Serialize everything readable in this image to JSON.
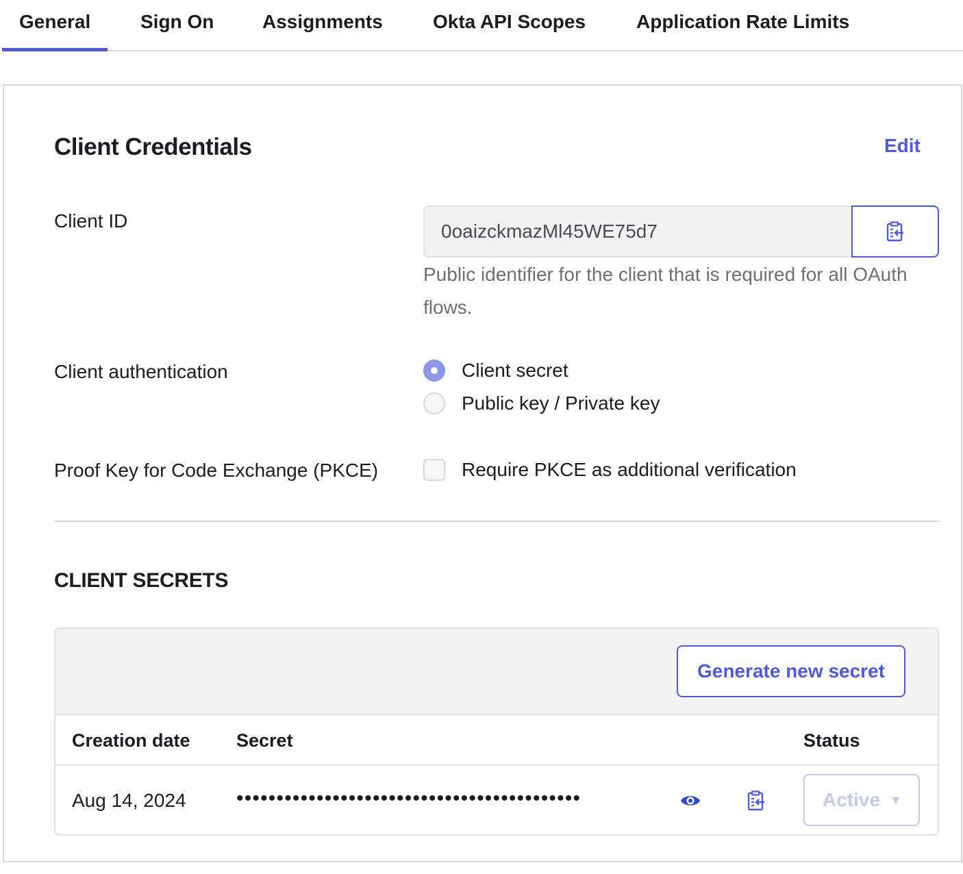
{
  "tabs": [
    {
      "label": "General",
      "active": true
    },
    {
      "label": "Sign On",
      "active": false
    },
    {
      "label": "Assignments",
      "active": false
    },
    {
      "label": "Okta API Scopes",
      "active": false
    },
    {
      "label": "Application Rate Limits",
      "active": false
    }
  ],
  "credentials": {
    "title": "Client Credentials",
    "edit_label": "Edit",
    "client_id_label": "Client ID",
    "client_id_value": "0oaizckmazMl45WE75d7",
    "client_id_help": "Public identifier for the client that is required for all OAuth flows.",
    "auth_label": "Client authentication",
    "auth_options": [
      {
        "label": "Client secret",
        "selected": true
      },
      {
        "label": "Public key / Private key",
        "selected": false
      }
    ],
    "pkce_label": "Proof Key for Code Exchange (PKCE)",
    "pkce_option": "Require PKCE as additional verification",
    "pkce_checked": false
  },
  "secrets": {
    "title": "CLIENT SECRETS",
    "generate_label": "Generate new secret",
    "columns": {
      "date": "Creation date",
      "secret": "Secret",
      "status": "Status"
    },
    "rows": [
      {
        "date": "Aug 14, 2024",
        "secret": "•••••••••••••••••••••••••••••••••••••••••••",
        "status": "Active"
      }
    ]
  },
  "colors": {
    "accent": "#4f5bd5",
    "radio_checked": "#8d96e8",
    "status_disabled": "#c5cbe8"
  },
  "icons": {
    "copy": "clipboard-copy-icon",
    "reveal": "eye-icon",
    "caret": "caret-down-icon"
  }
}
